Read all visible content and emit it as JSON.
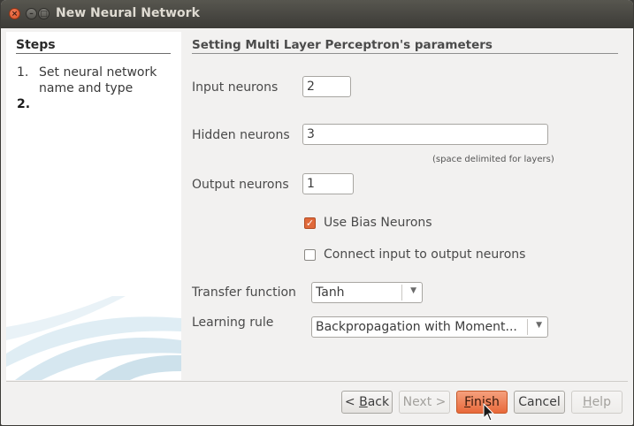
{
  "window": {
    "title": "New Neural Network",
    "controls": {
      "close": "×",
      "minimize": "–",
      "maximize": "□"
    }
  },
  "steps": {
    "title": "Steps",
    "items": [
      {
        "num": "1.",
        "label": "Set neural network name and type"
      },
      {
        "num": "2.",
        "label": ""
      }
    ]
  },
  "form": {
    "heading": "Setting Multi Layer Perceptron's parameters",
    "input_neurons": {
      "label": "Input neurons",
      "value": "2"
    },
    "hidden_neurons": {
      "label": "Hidden neurons",
      "value": "3",
      "hint": "(space delimited for layers)"
    },
    "output_neurons": {
      "label": "Output neurons",
      "value": "1"
    },
    "use_bias": {
      "label": "Use Bias Neurons",
      "checked": true
    },
    "connect_io": {
      "label": "Connect input to output neurons",
      "checked": false
    },
    "transfer_function": {
      "label": "Transfer function",
      "value": "Tanh"
    },
    "learning_rule": {
      "label": "Learning rule",
      "value": "Backpropagation with Moment..."
    }
  },
  "buttons": {
    "back": {
      "prefix": "< ",
      "mnemonic": "B",
      "rest": "ack"
    },
    "next": "Next >",
    "finish": {
      "mnemonic": "F",
      "rest": "inish"
    },
    "cancel": "Cancel",
    "help": {
      "mnemonic": "H",
      "rest": "elp"
    }
  },
  "colors": {
    "accent": "#e8693a",
    "titlebar": "#3c3b37"
  },
  "icons": {
    "cursor": "pointer-arrow-icon",
    "dropdown": "chevron-down-icon",
    "check": "checkmark-icon"
  }
}
